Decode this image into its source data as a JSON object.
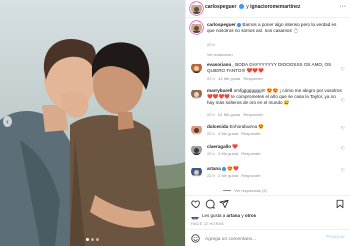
{
  "post": {
    "author": "carlospeguer",
    "coauthor_joiner": "y",
    "coauthor": "ignacioromemartinez",
    "verified_icon": "verified-badge-icon",
    "more_icon": "ellipsis-icon",
    "carousel": {
      "slides": 3,
      "active": 1
    }
  },
  "caption": {
    "username": "carlospeguer",
    "text": "Bamos a poner algo intenso pero la verdad es que nosotros no somos así. nos casamos 💍",
    "time": "22 h"
  },
  "translation": "Ver traducción",
  "comments": [
    {
      "username": "evasoriano_",
      "text": "BODA GAYYYYYYY DIOOOSSS OS AMO, OS QUIERO TANTO!!! ❤️❤️❤️",
      "time": "22 h",
      "likes": "44 Me gusta",
      "reply": "Responder",
      "avatar_color": "#b5683c"
    },
    {
      "username": "marryburell",
      "text": "omfgggggggg!!! 😍😍 ¡ cómo me alegro por vosotros ❤️❤️❤️❤️ te comprometes el año que se casa la Taylor, ya no hay más solteros de oro en el mundo 😅",
      "time": "22 h",
      "likes": "61 Me gusta",
      "reply": "Responder",
      "avatar_color": "#8c6d5a"
    },
    {
      "username": "dulcecida",
      "text": "Enhorabuena 😍",
      "time": "22 h",
      "likes": "4 Me gusta",
      "reply": "Responder",
      "avatar_color": "#d89a7a"
    },
    {
      "username": "claeragallo",
      "text": "❤️",
      "time": "22 h",
      "likes": "3 Me gusta",
      "reply": "Responder",
      "avatar_color": "#a0a0a0"
    },
    {
      "username": "artana",
      "text": "😍❤️",
      "time": "22 h",
      "likes": "2 Me gusta",
      "reply": "Responder",
      "avatar_color": "#3c5a8c"
    }
  ],
  "view_replies": "Ver respuestas (3)",
  "actions": [
    "heart-icon",
    "comment-icon",
    "share-icon",
    "bookmark-icon"
  ],
  "liked_by": {
    "prefix": "Les gusta a",
    "user": "artana",
    "joiner": "y",
    "others": "otros"
  },
  "date": "HACE 22 HORAS",
  "add_comment": {
    "placeholder": "Agrega un comentario...",
    "publish": "Publicar",
    "emoji_icon": "smiley-icon"
  }
}
